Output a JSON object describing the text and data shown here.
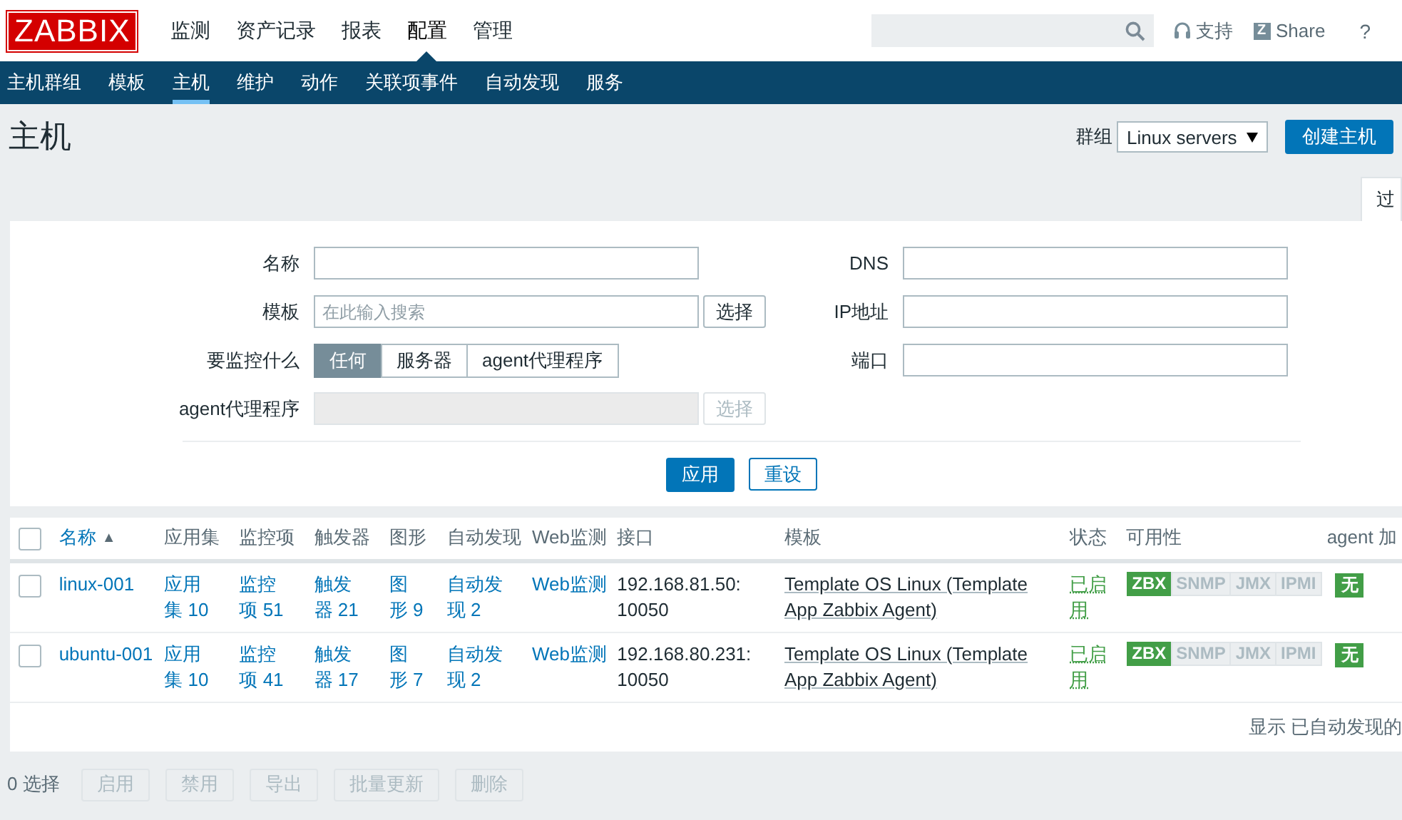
{
  "header": {
    "logo": "ZABBIX",
    "menu": [
      {
        "label": "监测",
        "selected": false
      },
      {
        "label": "资产记录",
        "selected": false
      },
      {
        "label": "报表",
        "selected": false
      },
      {
        "label": "配置",
        "selected": true
      },
      {
        "label": "管理",
        "selected": false
      }
    ],
    "support": "支持",
    "share": {
      "badge": "Z",
      "label": "Share"
    },
    "help": "?"
  },
  "subnav": [
    {
      "label": "主机群组",
      "selected": false
    },
    {
      "label": "模板",
      "selected": false
    },
    {
      "label": "主机",
      "selected": true
    },
    {
      "label": "维护",
      "selected": false
    },
    {
      "label": "动作",
      "selected": false
    },
    {
      "label": "关联项事件",
      "selected": false
    },
    {
      "label": "自动发现",
      "selected": false
    },
    {
      "label": "服务",
      "selected": false
    }
  ],
  "page": {
    "title": "主机",
    "group_label": "群组",
    "group_value": "Linux servers",
    "create_button": "创建主机"
  },
  "filter": {
    "tab": "过",
    "left": [
      {
        "kind": "text",
        "label": "名称"
      },
      {
        "kind": "multiselect",
        "label": "模板",
        "placeholder": "在此输入搜索",
        "button": "选择",
        "disabled": false
      },
      {
        "kind": "segmented",
        "label": "要监控什么",
        "options": [
          {
            "label": "任何",
            "selected": true
          },
          {
            "label": "服务器",
            "selected": false
          },
          {
            "label": "agent代理程序",
            "selected": false
          }
        ]
      },
      {
        "kind": "multiselect",
        "label": "agent代理程序",
        "button": "选择",
        "disabled": true
      }
    ],
    "right": [
      {
        "kind": "text",
        "label": "DNS"
      },
      {
        "kind": "text",
        "label": "IP地址"
      },
      {
        "kind": "text",
        "label": "端口"
      }
    ],
    "apply": "应用",
    "reset": "重设"
  },
  "table": {
    "all_checked": false,
    "columns": [
      {
        "label": "名称",
        "sort_mark": "▲"
      },
      {
        "label": "应用集"
      },
      {
        "label": "监控项"
      },
      {
        "label": "触发器"
      },
      {
        "label": "图形"
      },
      {
        "label": "自动发现"
      },
      {
        "label": "Web监测"
      },
      {
        "label": "接口"
      },
      {
        "label": "模板"
      },
      {
        "label": "状态"
      },
      {
        "label": "可用性"
      },
      {
        "label": "agent 加"
      }
    ],
    "rows": [
      {
        "checked": false,
        "name": "linux-001",
        "applications": "应用集 10",
        "items": "监控项 51",
        "triggers": "触发器 21",
        "graphs": "图形 9",
        "discovery": "自动发现 2",
        "web": "Web监测",
        "interface": "192.168.81.50: 10050",
        "templates": "Template OS Linux (Template App Zabbix Agent)",
        "status": {
          "label": "已启用",
          "enabled": true
        },
        "availability": [
          {
            "label": "ZBX",
            "available": true
          },
          {
            "label": "SNMP",
            "available": false
          },
          {
            "label": "JMX",
            "available": false
          },
          {
            "label": "IPMI",
            "available": false
          }
        ],
        "encryption": "无"
      },
      {
        "checked": false,
        "name": "ubuntu-001",
        "applications": "应用集 10",
        "items": "监控项 41",
        "triggers": "触发器 17",
        "graphs": "图形 7",
        "discovery": "自动发现 2",
        "web": "Web监测",
        "interface": "192.168.80.231: 10050",
        "templates": "Template OS Linux (Template App Zabbix Agent)",
        "status": {
          "label": "已启用",
          "enabled": true
        },
        "availability": [
          {
            "label": "ZBX",
            "available": true
          },
          {
            "label": "SNMP",
            "available": false
          },
          {
            "label": "JMX",
            "available": false
          },
          {
            "label": "IPMI",
            "available": false
          }
        ],
        "encryption": "无"
      }
    ],
    "footer": "显示 已自动发现的"
  },
  "bottom": {
    "selected_count": "0 选择",
    "buttons": [
      {
        "label": "启用",
        "disabled": true
      },
      {
        "label": "禁用",
        "disabled": true
      },
      {
        "label": "导出",
        "disabled": true
      },
      {
        "label": "批量更新",
        "disabled": true
      },
      {
        "label": "删除",
        "disabled": true
      }
    ]
  }
}
